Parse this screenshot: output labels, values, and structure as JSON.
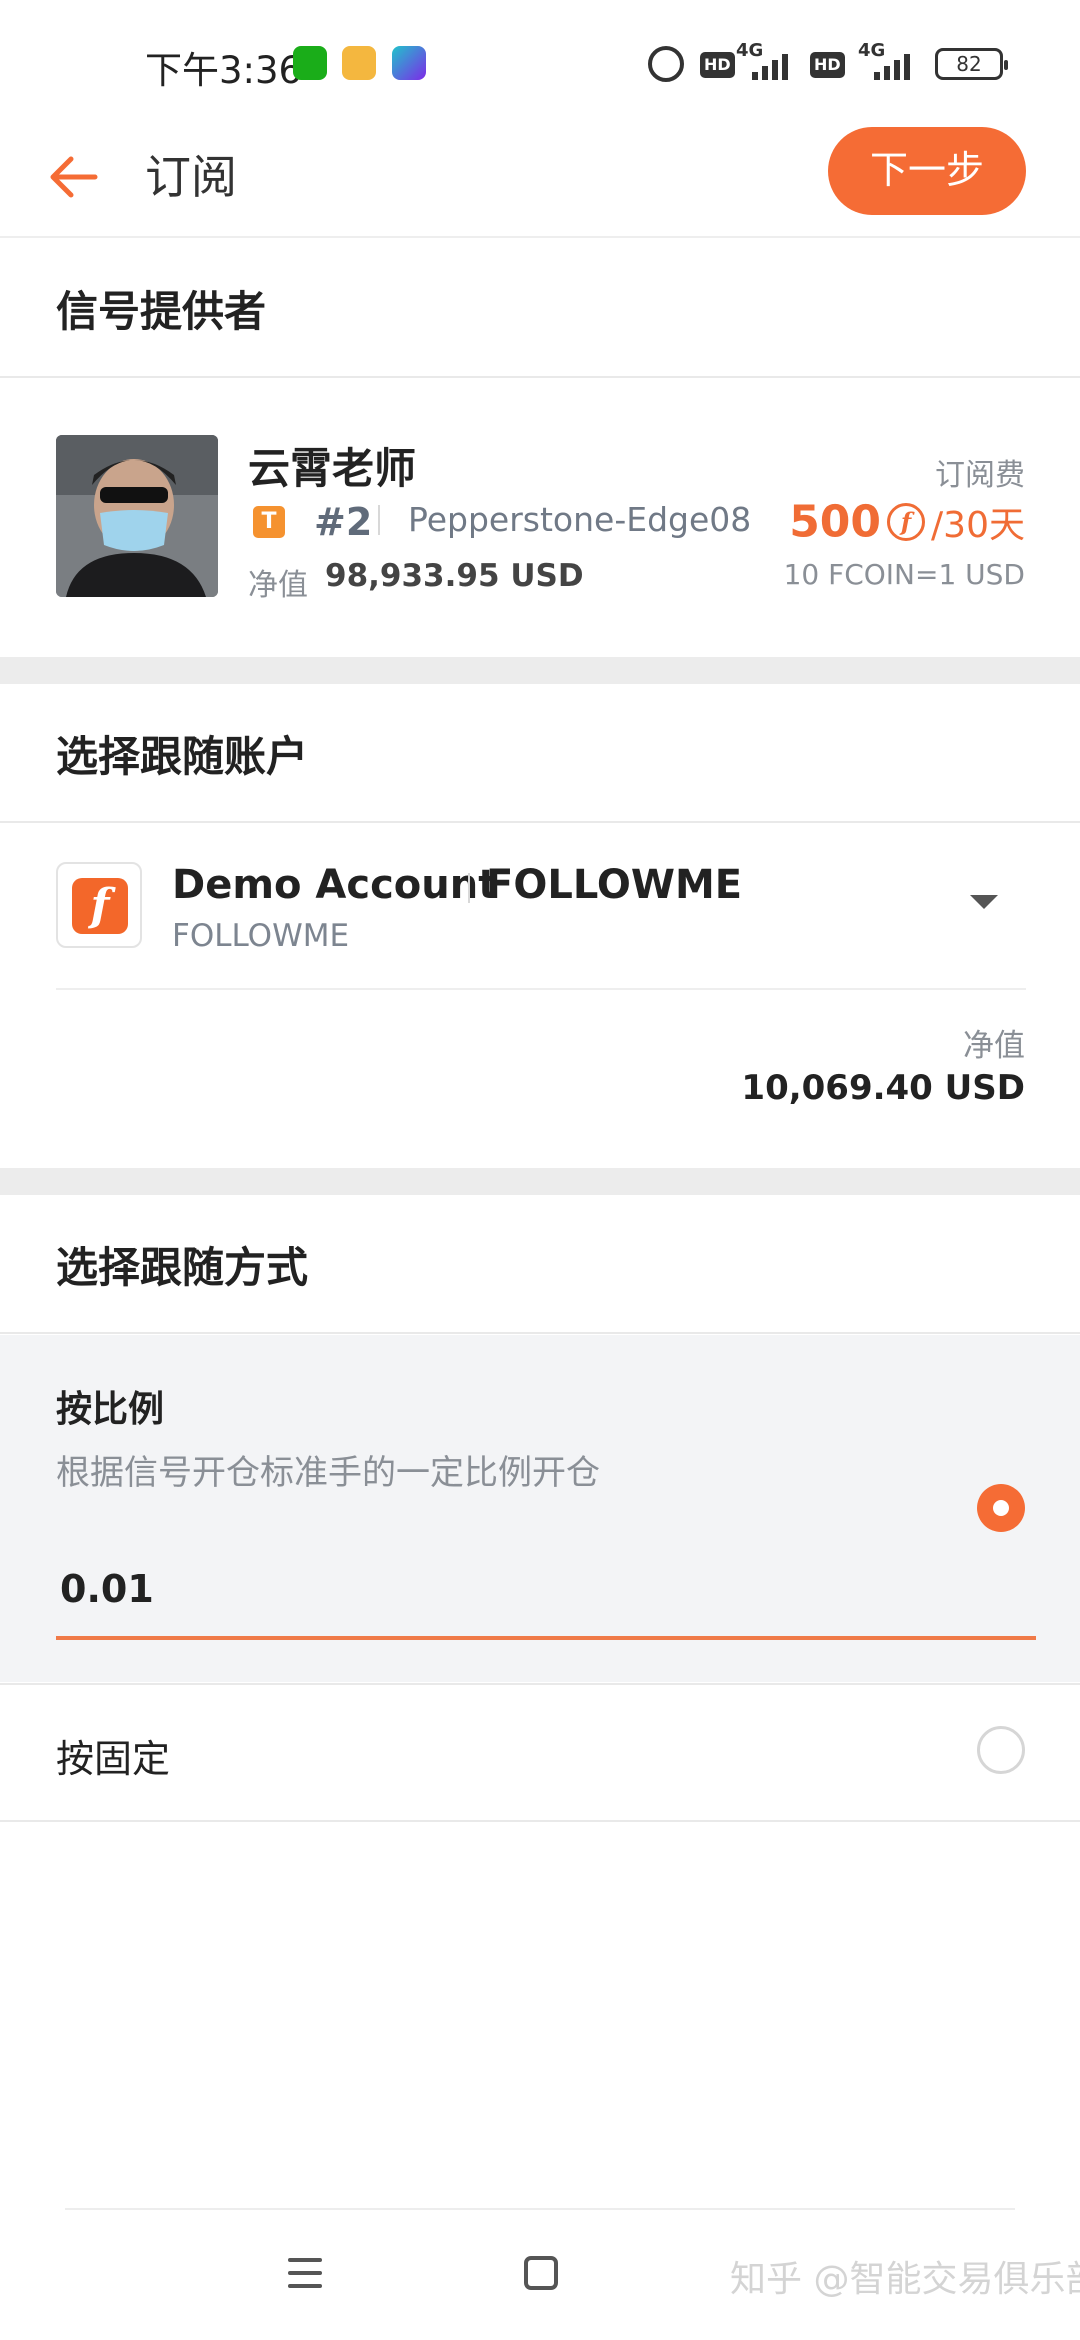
{
  "status_bar": {
    "time": "下午3:36",
    "net1": "4G",
    "net2": "4G",
    "battery": "82"
  },
  "header": {
    "title": "订阅",
    "next_label": "下一步"
  },
  "provider_section": {
    "title": "信号提供者",
    "name": "云霄老师",
    "badge": "T",
    "rank": "#2",
    "server": "Pepperstone-Edge08",
    "equity_label": "净值",
    "equity_value": "98,933.95 USD",
    "fee_label": "订阅费",
    "fee_amount": "500",
    "fee_coin_symbol": "f",
    "fee_period": "/30天",
    "rate": "10 FCOIN=1 USD"
  },
  "account_section": {
    "title": "选择跟随账户",
    "logo_letter": "f",
    "account_name": "Demo Account",
    "broker": "FOLLOWME",
    "sub": "FOLLOWME",
    "equity_label": "净值",
    "equity_value": "10,069.40 USD"
  },
  "mode_section": {
    "title": "选择跟随方式",
    "ratio_title": "按比例",
    "ratio_desc": "根据信号开仓标准手的一定比例开仓",
    "ratio_value": "0.01",
    "fixed_label": "按固定",
    "selected": "ratio"
  },
  "watermark": "知乎 @智能交易俱乐部",
  "colors": {
    "accent": "#f56c35",
    "text": "#222222",
    "muted": "#8a8f96"
  }
}
